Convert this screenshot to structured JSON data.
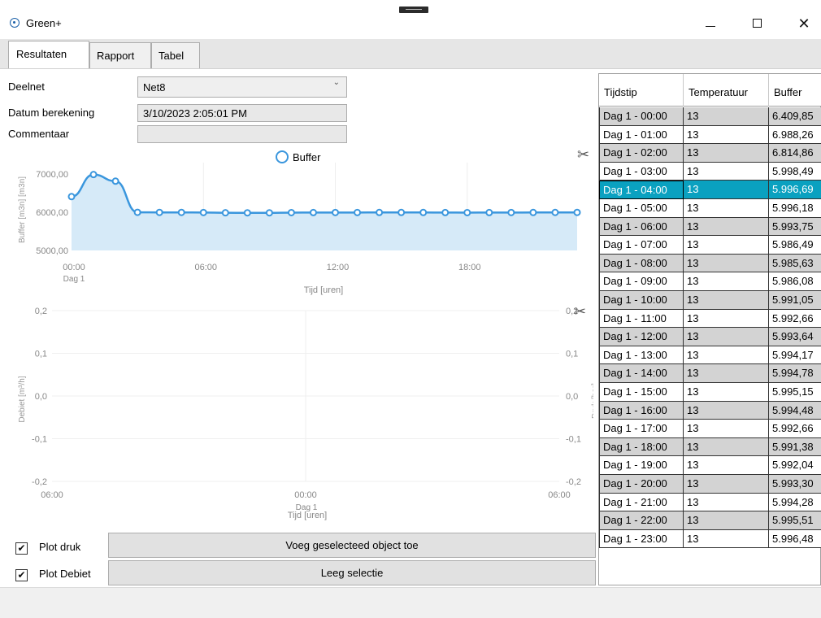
{
  "window": {
    "title": "Green+",
    "icon": "gauge-icon",
    "controls": {
      "minimize": "minimize-icon",
      "maximize": "maximize-icon",
      "close": "✕"
    }
  },
  "tabs": [
    {
      "label": "Resultaten",
      "active": true
    },
    {
      "label": "Rapport",
      "active": false
    },
    {
      "label": "Tabel",
      "active": false
    }
  ],
  "form": {
    "deelnet_label": "Deelnet",
    "deelnet_value": "Net8",
    "datum_label": "Datum berekening",
    "datum_value": "3/10/2023 2:05:01 PM",
    "commentaar_label": "Commentaar",
    "commentaar_value": ""
  },
  "chart_data": [
    {
      "type": "area",
      "title": "",
      "legend": [
        "Buffer"
      ],
      "legend_position": "top",
      "xlabel": "Tijd [uren]",
      "ylabel": "Buffer [m3n] [m3n]",
      "x_ticks": [
        "00:00",
        "06:00",
        "12:00",
        "18:00"
      ],
      "x_subtick": "Dag 1",
      "y_ticks": [
        "7000,00",
        "6000,00",
        "5000,00"
      ],
      "ylim": [
        5000,
        7300
      ],
      "xlim": [
        0,
        23
      ],
      "series": [
        {
          "name": "Buffer",
          "color": "#3a96dd",
          "fill": "#d6eaf8",
          "x": [
            0,
            1,
            2,
            3,
            4,
            5,
            6,
            7,
            8,
            9,
            10,
            11,
            12,
            13,
            14,
            15,
            16,
            17,
            18,
            19,
            20,
            21,
            22,
            23
          ],
          "values": [
            6409.85,
            6988.26,
            6814.86,
            5998.49,
            5996.69,
            5996.18,
            5993.75,
            5986.49,
            5985.63,
            5986.08,
            5991.05,
            5992.66,
            5993.64,
            5994.17,
            5994.78,
            5995.15,
            5994.48,
            5992.66,
            5991.38,
            5992.04,
            5993.3,
            5994.28,
            5995.51,
            5996.48
          ]
        }
      ]
    },
    {
      "type": "line",
      "title": "",
      "xlabel": "Tijd [uren]",
      "ylabel": "Debiet [m³/h]",
      "y2label": "Druk [bar]",
      "x_ticks": [
        "06:00",
        "00:00",
        "06:00"
      ],
      "x_subtick": "Dag 1",
      "y_ticks": [
        "0,2",
        "0,1",
        "0,0",
        "-0,1",
        "-0,2"
      ],
      "y2_ticks": [
        "0,2",
        "0,1",
        "0,0",
        "-0,1",
        "-0,2"
      ],
      "ylim": [
        -0.2,
        0.2
      ],
      "grid": true,
      "series": []
    }
  ],
  "controls": {
    "plot_druk_label": "Plot druk",
    "plot_druk_checked": true,
    "plot_debiet_label": "Plot Debiet",
    "plot_debiet_checked": true,
    "add_button": "Voeg geselecteed object toe",
    "clear_button": "Leeg selectie"
  },
  "table": {
    "columns": [
      "Tijdstip",
      "Temperatuur",
      "Buffer"
    ],
    "selected_index": 4,
    "rows": [
      [
        "Dag 1 - 00:00",
        "13",
        "6.409,85"
      ],
      [
        "Dag 1 - 01:00",
        "13",
        "6.988,26"
      ],
      [
        "Dag 1 - 02:00",
        "13",
        "6.814,86"
      ],
      [
        "Dag 1 - 03:00",
        "13",
        "5.998,49"
      ],
      [
        "Dag 1 - 04:00",
        "13",
        "5.996,69"
      ],
      [
        "Dag 1 - 05:00",
        "13",
        "5.996,18"
      ],
      [
        "Dag 1 - 06:00",
        "13",
        "5.993,75"
      ],
      [
        "Dag 1 - 07:00",
        "13",
        "5.986,49"
      ],
      [
        "Dag 1 - 08:00",
        "13",
        "5.985,63"
      ],
      [
        "Dag 1 - 09:00",
        "13",
        "5.986,08"
      ],
      [
        "Dag 1 - 10:00",
        "13",
        "5.991,05"
      ],
      [
        "Dag 1 - 11:00",
        "13",
        "5.992,66"
      ],
      [
        "Dag 1 - 12:00",
        "13",
        "5.993,64"
      ],
      [
        "Dag 1 - 13:00",
        "13",
        "5.994,17"
      ],
      [
        "Dag 1 - 14:00",
        "13",
        "5.994,78"
      ],
      [
        "Dag 1 - 15:00",
        "13",
        "5.995,15"
      ],
      [
        "Dag 1 - 16:00",
        "13",
        "5.994,48"
      ],
      [
        "Dag 1 - 17:00",
        "13",
        "5.992,66"
      ],
      [
        "Dag 1 - 18:00",
        "13",
        "5.991,38"
      ],
      [
        "Dag 1 - 19:00",
        "13",
        "5.992,04"
      ],
      [
        "Dag 1 - 20:00",
        "13",
        "5.993,30"
      ],
      [
        "Dag 1 - 21:00",
        "13",
        "5.994,28"
      ],
      [
        "Dag 1 - 22:00",
        "13",
        "5.995,51"
      ],
      [
        "Dag 1 - 23:00",
        "13",
        "5.996,48"
      ]
    ]
  }
}
